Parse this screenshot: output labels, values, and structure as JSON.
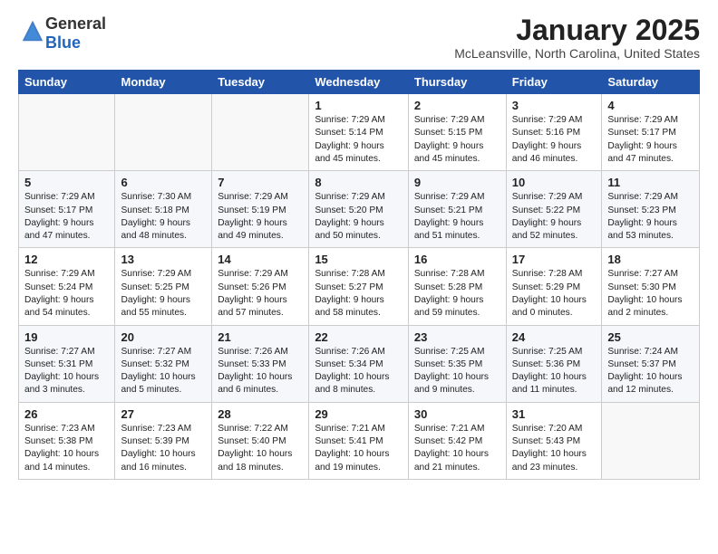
{
  "header": {
    "logo_general": "General",
    "logo_blue": "Blue",
    "month": "January 2025",
    "location": "McLeansville, North Carolina, United States"
  },
  "columns": [
    "Sunday",
    "Monday",
    "Tuesday",
    "Wednesday",
    "Thursday",
    "Friday",
    "Saturday"
  ],
  "weeks": [
    [
      {
        "day": "",
        "detail": ""
      },
      {
        "day": "",
        "detail": ""
      },
      {
        "day": "",
        "detail": ""
      },
      {
        "day": "1",
        "detail": "Sunrise: 7:29 AM\nSunset: 5:14 PM\nDaylight: 9 hours\nand 45 minutes."
      },
      {
        "day": "2",
        "detail": "Sunrise: 7:29 AM\nSunset: 5:15 PM\nDaylight: 9 hours\nand 45 minutes."
      },
      {
        "day": "3",
        "detail": "Sunrise: 7:29 AM\nSunset: 5:16 PM\nDaylight: 9 hours\nand 46 minutes."
      },
      {
        "day": "4",
        "detail": "Sunrise: 7:29 AM\nSunset: 5:17 PM\nDaylight: 9 hours\nand 47 minutes."
      }
    ],
    [
      {
        "day": "5",
        "detail": "Sunrise: 7:29 AM\nSunset: 5:17 PM\nDaylight: 9 hours\nand 47 minutes."
      },
      {
        "day": "6",
        "detail": "Sunrise: 7:30 AM\nSunset: 5:18 PM\nDaylight: 9 hours\nand 48 minutes."
      },
      {
        "day": "7",
        "detail": "Sunrise: 7:29 AM\nSunset: 5:19 PM\nDaylight: 9 hours\nand 49 minutes."
      },
      {
        "day": "8",
        "detail": "Sunrise: 7:29 AM\nSunset: 5:20 PM\nDaylight: 9 hours\nand 50 minutes."
      },
      {
        "day": "9",
        "detail": "Sunrise: 7:29 AM\nSunset: 5:21 PM\nDaylight: 9 hours\nand 51 minutes."
      },
      {
        "day": "10",
        "detail": "Sunrise: 7:29 AM\nSunset: 5:22 PM\nDaylight: 9 hours\nand 52 minutes."
      },
      {
        "day": "11",
        "detail": "Sunrise: 7:29 AM\nSunset: 5:23 PM\nDaylight: 9 hours\nand 53 minutes."
      }
    ],
    [
      {
        "day": "12",
        "detail": "Sunrise: 7:29 AM\nSunset: 5:24 PM\nDaylight: 9 hours\nand 54 minutes."
      },
      {
        "day": "13",
        "detail": "Sunrise: 7:29 AM\nSunset: 5:25 PM\nDaylight: 9 hours\nand 55 minutes."
      },
      {
        "day": "14",
        "detail": "Sunrise: 7:29 AM\nSunset: 5:26 PM\nDaylight: 9 hours\nand 57 minutes."
      },
      {
        "day": "15",
        "detail": "Sunrise: 7:28 AM\nSunset: 5:27 PM\nDaylight: 9 hours\nand 58 minutes."
      },
      {
        "day": "16",
        "detail": "Sunrise: 7:28 AM\nSunset: 5:28 PM\nDaylight: 9 hours\nand 59 minutes."
      },
      {
        "day": "17",
        "detail": "Sunrise: 7:28 AM\nSunset: 5:29 PM\nDaylight: 10 hours\nand 0 minutes."
      },
      {
        "day": "18",
        "detail": "Sunrise: 7:27 AM\nSunset: 5:30 PM\nDaylight: 10 hours\nand 2 minutes."
      }
    ],
    [
      {
        "day": "19",
        "detail": "Sunrise: 7:27 AM\nSunset: 5:31 PM\nDaylight: 10 hours\nand 3 minutes."
      },
      {
        "day": "20",
        "detail": "Sunrise: 7:27 AM\nSunset: 5:32 PM\nDaylight: 10 hours\nand 5 minutes."
      },
      {
        "day": "21",
        "detail": "Sunrise: 7:26 AM\nSunset: 5:33 PM\nDaylight: 10 hours\nand 6 minutes."
      },
      {
        "day": "22",
        "detail": "Sunrise: 7:26 AM\nSunset: 5:34 PM\nDaylight: 10 hours\nand 8 minutes."
      },
      {
        "day": "23",
        "detail": "Sunrise: 7:25 AM\nSunset: 5:35 PM\nDaylight: 10 hours\nand 9 minutes."
      },
      {
        "day": "24",
        "detail": "Sunrise: 7:25 AM\nSunset: 5:36 PM\nDaylight: 10 hours\nand 11 minutes."
      },
      {
        "day": "25",
        "detail": "Sunrise: 7:24 AM\nSunset: 5:37 PM\nDaylight: 10 hours\nand 12 minutes."
      }
    ],
    [
      {
        "day": "26",
        "detail": "Sunrise: 7:23 AM\nSunset: 5:38 PM\nDaylight: 10 hours\nand 14 minutes."
      },
      {
        "day": "27",
        "detail": "Sunrise: 7:23 AM\nSunset: 5:39 PM\nDaylight: 10 hours\nand 16 minutes."
      },
      {
        "day": "28",
        "detail": "Sunrise: 7:22 AM\nSunset: 5:40 PM\nDaylight: 10 hours\nand 18 minutes."
      },
      {
        "day": "29",
        "detail": "Sunrise: 7:21 AM\nSunset: 5:41 PM\nDaylight: 10 hours\nand 19 minutes."
      },
      {
        "day": "30",
        "detail": "Sunrise: 7:21 AM\nSunset: 5:42 PM\nDaylight: 10 hours\nand 21 minutes."
      },
      {
        "day": "31",
        "detail": "Sunrise: 7:20 AM\nSunset: 5:43 PM\nDaylight: 10 hours\nand 23 minutes."
      },
      {
        "day": "",
        "detail": ""
      }
    ]
  ]
}
